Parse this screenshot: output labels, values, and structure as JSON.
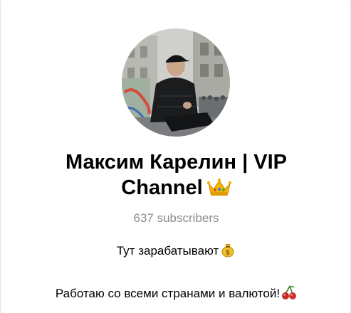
{
  "channel": {
    "title_line1": "Максим Карелин | VIP",
    "title_line2": "Channel",
    "title_icon": "crown-icon",
    "subscribers": "637 subscribers",
    "description_line1": "Тут зарабатывают",
    "description_line1_icon": "money-bag-icon",
    "description_line2": "Работаю со всеми странами и валютой!",
    "description_line2_icon": "cherries-icon"
  },
  "colors": {
    "background": "#ffffff",
    "muted_text": "#8a8d91",
    "text": "#000000"
  }
}
